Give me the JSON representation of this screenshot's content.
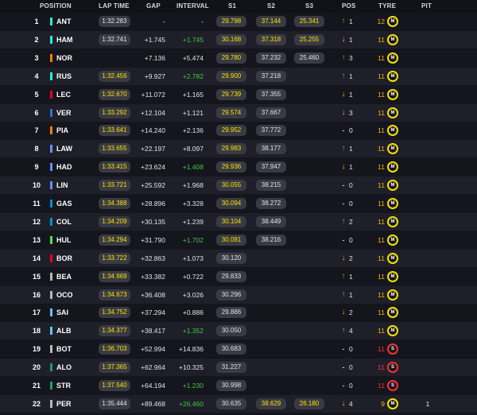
{
  "header": {
    "position": "POSITION",
    "lap_time": "LAP TIME",
    "gap": "GAP",
    "interval": "INTERVAL",
    "s1": "S1",
    "s2": "S2",
    "s3": "S3",
    "pos": "POS",
    "tyre": "TYRE",
    "pit": "PIT"
  },
  "colors": {
    "background": "#15151e",
    "row_alt": "#1f1f2a",
    "pill": "#3a3a44",
    "personal_best": "#4ee64e",
    "session_best_yellow": "#f7e400",
    "medium_tyre": "#f7e400",
    "soft_tyre": "#ff3030",
    "position_gain": "#43c743",
    "position_loss": "#f5b800"
  },
  "rows": [
    {
      "pos": "1",
      "driver": "ANT",
      "team_color": "#27f4d2",
      "lap": "1:32.283",
      "lap_best": false,
      "gap": "-",
      "interval": "-",
      "interval_green": false,
      "s1": "29.798",
      "s1_c": "yel",
      "s2": "37.144",
      "s2_c": "yel",
      "s3": "25.341",
      "s3_c": "yel",
      "arrow": "up",
      "pos_change": "1",
      "tyre_laps": "12",
      "tyre_laps_red": false,
      "tyre": "M",
      "tyre_type": "medium",
      "pit": ""
    },
    {
      "pos": "2",
      "driver": "HAM",
      "team_color": "#27f4d2",
      "lap": "1:32.741",
      "lap_best": false,
      "gap": "+1.745",
      "interval": "+1.745",
      "interval_green": true,
      "s1": "30.168",
      "s1_c": "yel",
      "s2": "37.318",
      "s2_c": "yel",
      "s3": "25.255",
      "s3_c": "yel",
      "arrow": "down",
      "pos_change": "1",
      "tyre_laps": "11",
      "tyre_laps_red": false,
      "tyre": "M",
      "tyre_type": "medium",
      "pit": ""
    },
    {
      "pos": "3",
      "driver": "NOR",
      "team_color": "#ff8000",
      "lap": "",
      "lap_best": false,
      "gap": "+7.136",
      "interval": "+5.474",
      "interval_green": false,
      "s1": "29.780",
      "s1_c": "yel",
      "s2": "37.232",
      "s2_c": "",
      "s3": "25.460",
      "s3_c": "",
      "arrow": "up",
      "pos_change": "3",
      "tyre_laps": "11",
      "tyre_laps_red": false,
      "tyre": "M",
      "tyre_type": "medium",
      "pit": ""
    },
    {
      "pos": "4",
      "driver": "RUS",
      "team_color": "#27f4d2",
      "lap": "1:32.456",
      "lap_best": true,
      "gap": "+9.927",
      "interval": "+2.782",
      "interval_green": true,
      "s1": "29.900",
      "s1_c": "yel",
      "s2": "37.218",
      "s2_c": "",
      "s3": "",
      "s3_c": "",
      "arrow": "up",
      "pos_change": "1",
      "tyre_laps": "11",
      "tyre_laps_red": false,
      "tyre": "M",
      "tyre_type": "medium",
      "pit": ""
    },
    {
      "pos": "5",
      "driver": "LEC",
      "team_color": "#e8002d",
      "lap": "1:32.670",
      "lap_best": true,
      "gap": "+11.072",
      "interval": "+1.165",
      "interval_green": false,
      "s1": "29.739",
      "s1_c": "yel",
      "s2": "37.355",
      "s2_c": "",
      "s3": "",
      "s3_c": "",
      "arrow": "down",
      "pos_change": "1",
      "tyre_laps": "11",
      "tyre_laps_red": false,
      "tyre": "M",
      "tyre_type": "medium",
      "pit": ""
    },
    {
      "pos": "6",
      "driver": "VER",
      "team_color": "#3671c6",
      "lap": "1:33.292",
      "lap_best": true,
      "gap": "+12.104",
      "interval": "+1.121",
      "interval_green": false,
      "s1": "29.574",
      "s1_c": "yel",
      "s2": "37.667",
      "s2_c": "",
      "s3": "",
      "s3_c": "",
      "arrow": "down",
      "pos_change": "3",
      "tyre_laps": "11",
      "tyre_laps_red": false,
      "tyre": "M",
      "tyre_type": "medium",
      "pit": ""
    },
    {
      "pos": "7",
      "driver": "PIA",
      "team_color": "#ff8000",
      "lap": "1:33.641",
      "lap_best": true,
      "gap": "+14.240",
      "interval": "+2.136",
      "interval_green": false,
      "s1": "29.952",
      "s1_c": "yel",
      "s2": "37.772",
      "s2_c": "",
      "s3": "",
      "s3_c": "",
      "arrow": "flat",
      "pos_change": "0",
      "tyre_laps": "11",
      "tyre_laps_red": false,
      "tyre": "M",
      "tyre_type": "medium",
      "pit": ""
    },
    {
      "pos": "8",
      "driver": "LAW",
      "team_color": "#6692ff",
      "lap": "1:33.655",
      "lap_best": true,
      "gap": "+22.197",
      "interval": "+8.097",
      "interval_green": false,
      "s1": "29.983",
      "s1_c": "yel",
      "s2": "38.177",
      "s2_c": "",
      "s3": "",
      "s3_c": "",
      "arrow": "up",
      "pos_change": "1",
      "tyre_laps": "11",
      "tyre_laps_red": false,
      "tyre": "M",
      "tyre_type": "medium",
      "pit": ""
    },
    {
      "pos": "9",
      "driver": "HAD",
      "team_color": "#6692ff",
      "lap": "1:33.415",
      "lap_best": true,
      "gap": "+23.624",
      "interval": "+1.408",
      "interval_green": true,
      "s1": "29.936",
      "s1_c": "yel",
      "s2": "37.947",
      "s2_c": "",
      "s3": "",
      "s3_c": "",
      "arrow": "down",
      "pos_change": "1",
      "tyre_laps": "11",
      "tyre_laps_red": false,
      "tyre": "M",
      "tyre_type": "medium",
      "pit": ""
    },
    {
      "pos": "10",
      "driver": "LIN",
      "team_color": "#6692ff",
      "lap": "1:33.721",
      "lap_best": true,
      "gap": "+25.592",
      "interval": "+1.968",
      "interval_green": false,
      "s1": "30.055",
      "s1_c": "yel",
      "s2": "38.215",
      "s2_c": "",
      "s3": "",
      "s3_c": "",
      "arrow": "flat",
      "pos_change": "0",
      "tyre_laps": "11",
      "tyre_laps_red": false,
      "tyre": "M",
      "tyre_type": "medium",
      "pit": ""
    },
    {
      "pos": "11",
      "driver": "GAS",
      "team_color": "#0093cc",
      "lap": "1:34.388",
      "lap_best": true,
      "gap": "+28.896",
      "interval": "+3.328",
      "interval_green": false,
      "s1": "30.094",
      "s1_c": "yel",
      "s2": "38.272",
      "s2_c": "",
      "s3": "",
      "s3_c": "",
      "arrow": "flat",
      "pos_change": "0",
      "tyre_laps": "11",
      "tyre_laps_red": false,
      "tyre": "M",
      "tyre_type": "medium",
      "pit": ""
    },
    {
      "pos": "12",
      "driver": "COL",
      "team_color": "#0093cc",
      "lap": "1:34.209",
      "lap_best": true,
      "gap": "+30.135",
      "interval": "+1.239",
      "interval_green": false,
      "s1": "30.104",
      "s1_c": "yel",
      "s2": "38.449",
      "s2_c": "",
      "s3": "",
      "s3_c": "",
      "arrow": "up",
      "pos_change": "2",
      "tyre_laps": "11",
      "tyre_laps_red": false,
      "tyre": "M",
      "tyre_type": "medium",
      "pit": ""
    },
    {
      "pos": "13",
      "driver": "HUL",
      "team_color": "#52e252",
      "lap": "1:34.294",
      "lap_best": true,
      "gap": "+31.790",
      "interval": "+1.702",
      "interval_green": true,
      "s1": "30.081",
      "s1_c": "yel",
      "s2": "38.216",
      "s2_c": "",
      "s3": "",
      "s3_c": "",
      "arrow": "flat",
      "pos_change": "0",
      "tyre_laps": "11",
      "tyre_laps_red": false,
      "tyre": "M",
      "tyre_type": "medium",
      "pit": ""
    },
    {
      "pos": "14",
      "driver": "BOR",
      "team_color": "#e8002d",
      "lap": "1:33.722",
      "lap_best": true,
      "gap": "+32.863",
      "interval": "+1.073",
      "interval_green": false,
      "s1": "30.120",
      "s1_c": "",
      "s2": "",
      "s2_c": "",
      "s3": "",
      "s3_c": "",
      "arrow": "down",
      "pos_change": "2",
      "tyre_laps": "11",
      "tyre_laps_red": false,
      "tyre": "M",
      "tyre_type": "medium",
      "pit": ""
    },
    {
      "pos": "15",
      "driver": "BEA",
      "team_color": "#b6babd",
      "lap": "1:34.969",
      "lap_best": true,
      "gap": "+33.382",
      "interval": "+0.722",
      "interval_green": false,
      "s1": "29.833",
      "s1_c": "",
      "s2": "",
      "s2_c": "",
      "s3": "",
      "s3_c": "",
      "arrow": "up",
      "pos_change": "1",
      "tyre_laps": "11",
      "tyre_laps_red": false,
      "tyre": "M",
      "tyre_type": "medium",
      "pit": ""
    },
    {
      "pos": "16",
      "driver": "OCO",
      "team_color": "#b6babd",
      "lap": "1:34.673",
      "lap_best": true,
      "gap": "+36.408",
      "interval": "+3.026",
      "interval_green": false,
      "s1": "30.296",
      "s1_c": "",
      "s2": "",
      "s2_c": "",
      "s3": "",
      "s3_c": "",
      "arrow": "up",
      "pos_change": "1",
      "tyre_laps": "11",
      "tyre_laps_red": false,
      "tyre": "M",
      "tyre_type": "medium",
      "pit": ""
    },
    {
      "pos": "17",
      "driver": "SAI",
      "team_color": "#64c4ff",
      "lap": "1:34.752",
      "lap_best": true,
      "gap": "+37.294",
      "interval": "+0.886",
      "interval_green": false,
      "s1": "29.886",
      "s1_c": "",
      "s2": "",
      "s2_c": "",
      "s3": "",
      "s3_c": "",
      "arrow": "down",
      "pos_change": "2",
      "tyre_laps": "11",
      "tyre_laps_red": false,
      "tyre": "M",
      "tyre_type": "medium",
      "pit": ""
    },
    {
      "pos": "18",
      "driver": "ALB",
      "team_color": "#64c4ff",
      "lap": "1:34.377",
      "lap_best": true,
      "gap": "+38.417",
      "interval": "+1.352",
      "interval_green": true,
      "s1": "30.050",
      "s1_c": "",
      "s2": "",
      "s2_c": "",
      "s3": "",
      "s3_c": "",
      "arrow": "up",
      "pos_change": "4",
      "tyre_laps": "11",
      "tyre_laps_red": false,
      "tyre": "M",
      "tyre_type": "medium",
      "pit": ""
    },
    {
      "pos": "19",
      "driver": "BOT",
      "team_color": "#b6babd",
      "lap": "1:36.703",
      "lap_best": true,
      "gap": "+52.994",
      "interval": "+14.836",
      "interval_green": false,
      "s1": "30.683",
      "s1_c": "",
      "s2": "",
      "s2_c": "",
      "s3": "",
      "s3_c": "",
      "arrow": "flat",
      "pos_change": "0",
      "tyre_laps": "11",
      "tyre_laps_red": true,
      "tyre": "S",
      "tyre_type": "soft",
      "pit": ""
    },
    {
      "pos": "20",
      "driver": "ALO",
      "team_color": "#229971",
      "lap": "1:37.365",
      "lap_best": true,
      "gap": "+62.964",
      "interval": "+10.325",
      "interval_green": false,
      "s1": "31.227",
      "s1_c": "",
      "s2": "",
      "s2_c": "",
      "s3": "",
      "s3_c": "",
      "arrow": "flat",
      "pos_change": "0",
      "tyre_laps": "11",
      "tyre_laps_red": true,
      "tyre": "S",
      "tyre_type": "soft",
      "pit": ""
    },
    {
      "pos": "21",
      "driver": "STR",
      "team_color": "#229971",
      "lap": "1:37.540",
      "lap_best": true,
      "gap": "+64.194",
      "interval": "+1.230",
      "interval_green": true,
      "s1": "30.998",
      "s1_c": "",
      "s2": "",
      "s2_c": "",
      "s3": "",
      "s3_c": "",
      "arrow": "flat",
      "pos_change": "0",
      "tyre_laps": "11",
      "tyre_laps_red": true,
      "tyre": "S",
      "tyre_type": "soft",
      "pit": ""
    },
    {
      "pos": "22",
      "driver": "PER",
      "team_color": "#b6babd",
      "lap": "1:35.444",
      "lap_best": false,
      "gap": "+89.468",
      "interval": "+26.460",
      "interval_green": true,
      "s1": "30.635",
      "s1_c": "",
      "s2": "38.629",
      "s2_c": "yel",
      "s3": "26.180",
      "s3_c": "yel",
      "arrow": "down",
      "pos_change": "4",
      "tyre_laps": "9",
      "tyre_laps_red": false,
      "tyre": "M",
      "tyre_type": "medium",
      "pit": "1"
    }
  ]
}
